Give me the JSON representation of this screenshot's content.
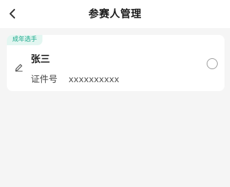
{
  "header": {
    "title": "参赛人管理",
    "back_icon": "chevron-left-icon"
  },
  "participants": [
    {
      "badge": "成年选手",
      "name": "张三",
      "id_label": "证件号",
      "id_value": "xxxxxxxxxx",
      "selected": false,
      "edit_icon": "pencil-icon"
    }
  ],
  "colors": {
    "accent": "#1aa88a",
    "badge_bg": "#e3f6f1",
    "page_bg": "#f5f5f5"
  }
}
